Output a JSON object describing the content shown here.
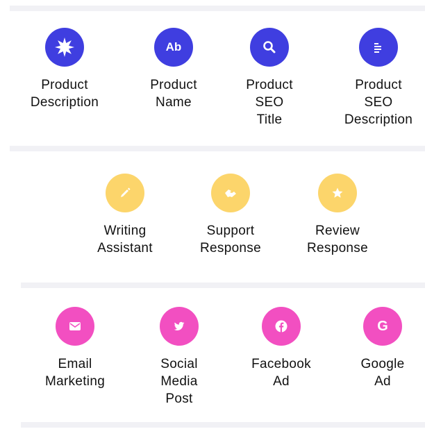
{
  "colors": {
    "blue": "#3f3ee0",
    "yellow": "#fcd56b",
    "pink": "#f24fc1",
    "divider": "#f1f1f5"
  },
  "sections": [
    {
      "name": "product-tools",
      "items": [
        {
          "label": "Product\nDescription",
          "icon": "starburst-icon"
        },
        {
          "label": "Product\nName",
          "icon": "ab-text-icon",
          "icon_text": "Ab"
        },
        {
          "label": "Product\nSEO\nTitle",
          "icon": "search-icon"
        },
        {
          "label": "Product\nSEO\nDescription",
          "icon": "text-lines-icon"
        }
      ]
    },
    {
      "name": "support-tools",
      "items": [
        {
          "label": "Writing\nAssistant",
          "icon": "pencil-icon"
        },
        {
          "label": "Support\nResponse",
          "icon": "handshake-icon"
        },
        {
          "label": "Review\nResponse",
          "icon": "star-icon"
        }
      ]
    },
    {
      "name": "marketing-tools",
      "items": [
        {
          "label": "Email\nMarketing",
          "icon": "envelope-icon"
        },
        {
          "label": "Social\nMedia\nPost",
          "icon": "twitter-icon"
        },
        {
          "label": "Facebook\nAd",
          "icon": "facebook-icon"
        },
        {
          "label": "Google\nAd",
          "icon": "google-icon",
          "icon_text": "G"
        }
      ]
    }
  ]
}
